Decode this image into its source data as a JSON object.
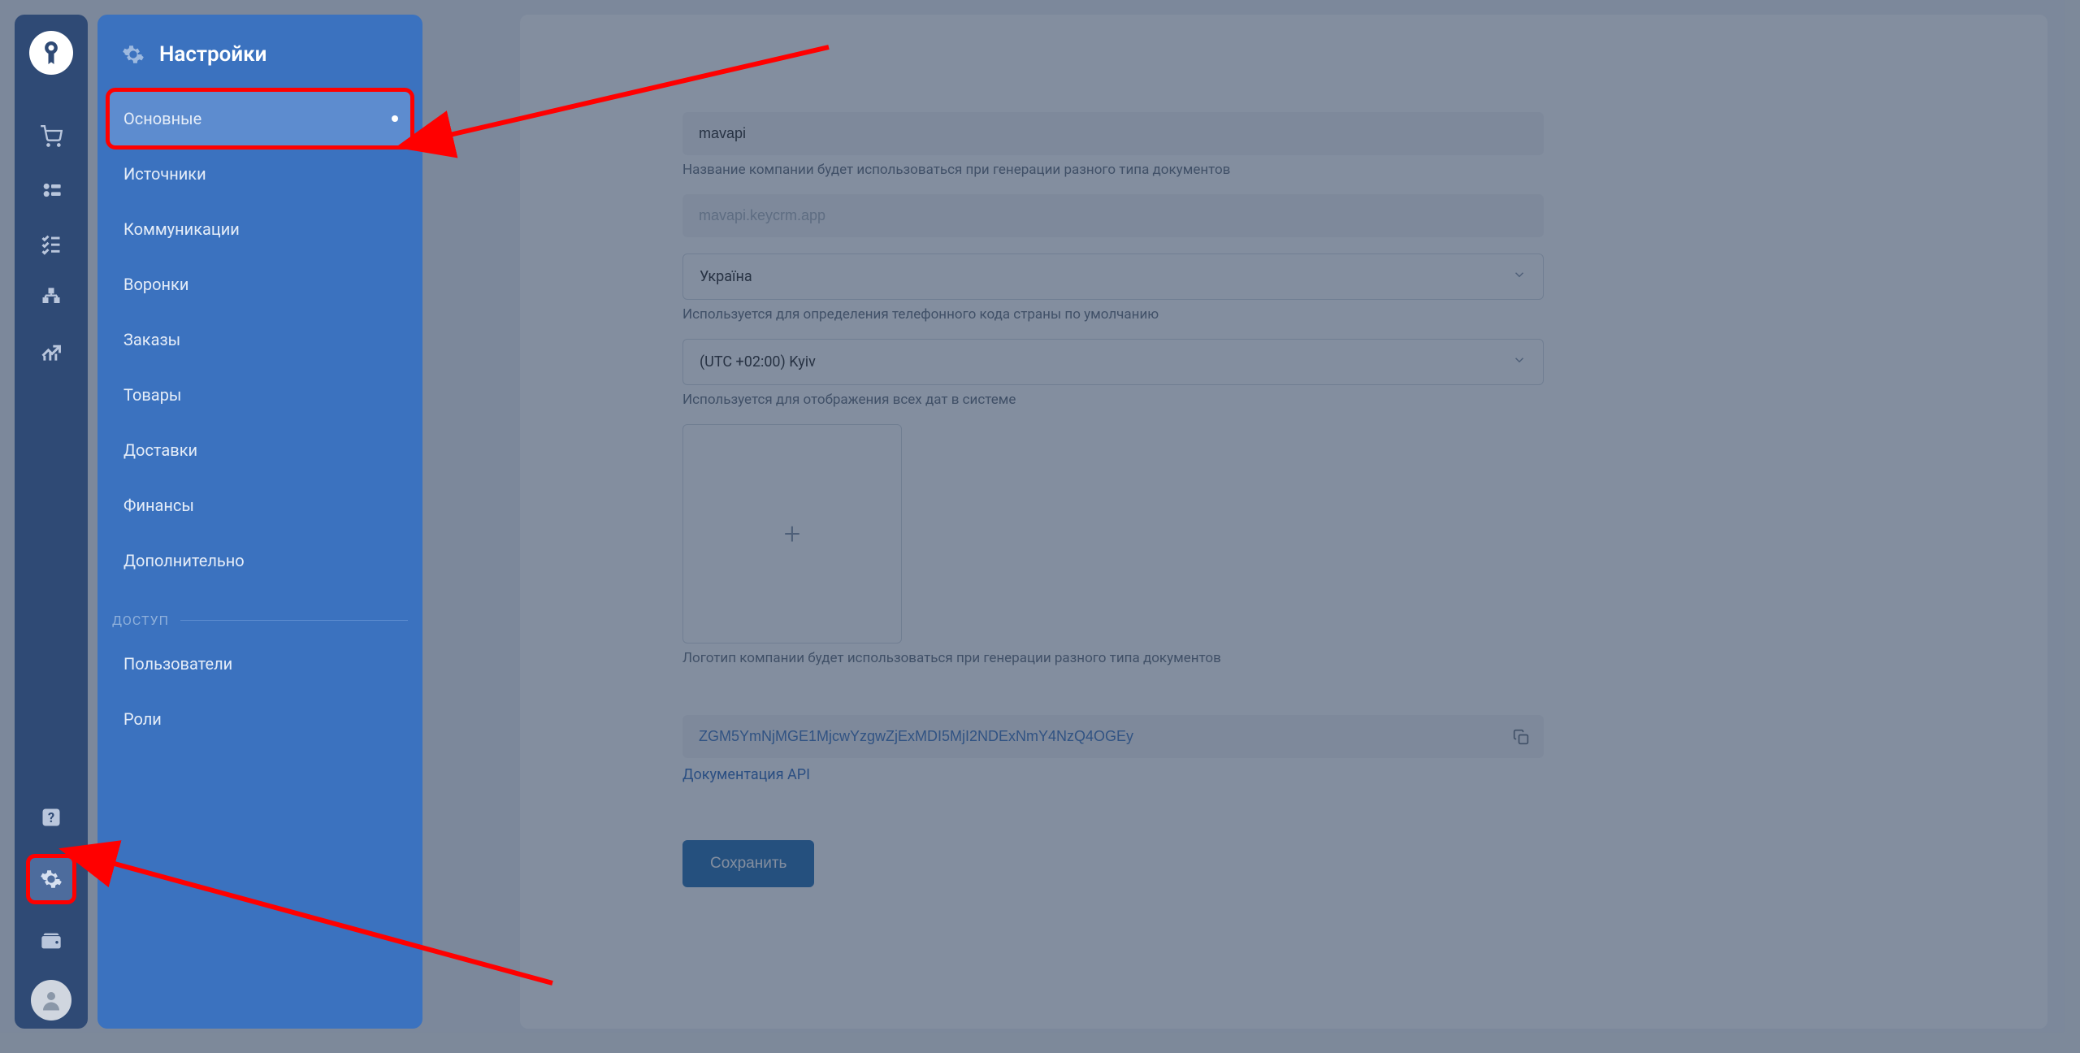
{
  "settings_panel": {
    "title": "Настройки",
    "items": [
      {
        "label": "Основные",
        "active": true,
        "highlighted": true
      },
      {
        "label": "Источники"
      },
      {
        "label": "Коммуникации"
      },
      {
        "label": "Воронки"
      },
      {
        "label": "Заказы"
      },
      {
        "label": "Товары"
      },
      {
        "label": "Доставки"
      },
      {
        "label": "Финансы"
      },
      {
        "label": "Дополнительно"
      }
    ],
    "access_section_label": "ДОСТУП",
    "access_items": [
      {
        "label": "Пользователи"
      },
      {
        "label": "Роли"
      }
    ]
  },
  "form": {
    "company_name": "mavapi",
    "company_name_help": "Название компании будет использоваться при генерации разного типа документов",
    "domain": "mavapi.keycrm.app",
    "country": "Україна",
    "country_help": "Используется для определения телефонного кода страны по умолчанию",
    "timezone": "(UTC +02:00) Kyiv",
    "timezone_help": "Используется для отображения всех дат в системе",
    "logo_help": "Логотип компании будет использоваться при генерации разного типа документов",
    "api_key": "ZGM5YmNjMGE1MjcwYzgwZjExMDI5MjI2NDExNmY4NzQ4OGEy",
    "api_doc_link": "Документация API",
    "save_button": "Сохранить"
  }
}
